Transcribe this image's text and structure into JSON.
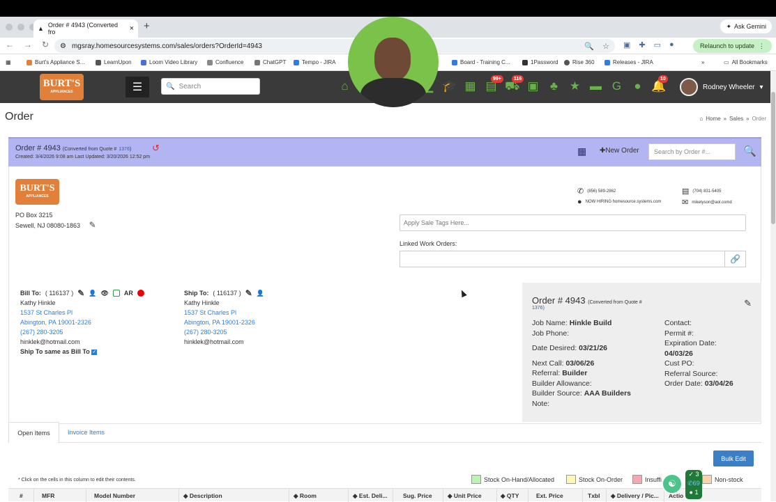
{
  "browser": {
    "tab_title": "Order # 4943 (Converted fro",
    "ask_gemini": "Ask Gemini",
    "url": "mgsray.homesourcesystems.com/sales/orders?OrderId=4943",
    "relaunch": "Relaunch to update",
    "bookmarks": [
      "Burt's Appliance S...",
      "LearnUpon",
      "Loom Video Library",
      "Confluence",
      "ChatGPT",
      "Tempo - JIRA",
      "Board - Training C...",
      "1Password",
      "Rise 360",
      "Releases - JIRA"
    ],
    "all_bookmarks": "All Bookmarks"
  },
  "nav": {
    "logo_text": "BURT'S",
    "logo_sub": "APPLIANCES",
    "search_placeholder": "Search",
    "cart_badge": "99+",
    "cart2_badge": "116",
    "bell_badge": "10",
    "user_name": "Rodney Wheeler"
  },
  "page": {
    "title": "Order",
    "breadcrumb": [
      "Home",
      "Sales",
      "Order"
    ]
  },
  "order_bar": {
    "title": "Order # 4943",
    "converted": "(Converted from Quote #",
    "quote_no": "1376",
    "close_paren": ")",
    "dates": "Created: 3/4/2026 9:08 am     Last Updated: 3/20/2026 12:52 pm",
    "new_order": "New Order",
    "search_placeholder": "Search by Order #..."
  },
  "company": {
    "address1": "PO Box 3215",
    "address2": "Sewell, NJ 08080-1863",
    "phone1": "(856) 589-2862",
    "phone2": "(704) 831-5405",
    "web": "NOW HIRING homesource.systems.com",
    "email": "miketyson@aol.comd"
  },
  "fields": {
    "tags_placeholder": "Apply Sale Tags Here...",
    "linked_label": "Linked Work Orders:"
  },
  "bill_to": {
    "label": "Bill To:",
    "id": "( 116137 )",
    "ar": "AR",
    "name": "Kathy Hinkle",
    "street": "1537 St Charles Pl",
    "city": "Abington, PA 19001-2326",
    "phone": "(267) 280-3205",
    "email": "hinklek@hotmail.com",
    "same_label": "Ship To same as Bill To"
  },
  "ship_to": {
    "label": "Ship To:",
    "id": "( 116137 )",
    "name": "Kathy Hinkle",
    "street": "1537 St Charles Pl",
    "city": "Abington, PA 19001-2326",
    "phone": "(267) 280-3205",
    "email": "hinklek@hotmail.com"
  },
  "summary": {
    "title": "Order # 4943",
    "converted": "(Converted from Quote #",
    "quote_ref": "1376)",
    "job_name_l": "Job Name:",
    "job_name": "Hinkle Build",
    "job_phone_l": "Job Phone:",
    "date_desired_l": "Date Desired:",
    "date_desired": "03/21/26",
    "next_call_l": "Next Call:",
    "next_call": "03/06/26",
    "referral_l": "Referral:",
    "referral": "Builder",
    "builder_allow_l": "Builder Allowance:",
    "builder_src_l": "Builder Source:",
    "builder_src": "AAA Builders",
    "note_l": "Note:",
    "contact_l": "Contact:",
    "permit_l": "Permit #:",
    "exp_l": "Expiration Date:",
    "exp": "04/03/26",
    "cust_po_l": "Cust PO:",
    "ref_src_l": "Referral Source:",
    "order_date_l": "Order Date:",
    "order_date": "03/04/26"
  },
  "tabs": {
    "open": "Open Items",
    "invoice": "Invoice Items"
  },
  "table": {
    "bulk_edit": "Bulk Edit",
    "note": "* Click on the cells in this column to edit their contents.",
    "legend": [
      {
        "label": "Stock On-Hand/Allocated",
        "color": "#b9f5b0"
      },
      {
        "label": "Stock On-Order",
        "color": "#fdf7b2"
      },
      {
        "label": "Insuffi",
        "color": "#f6a7b0"
      },
      {
        "label": "Non-stock",
        "color": "#fbd3a8"
      }
    ],
    "headers": [
      "#",
      "MFR",
      "Model Number",
      "Description",
      "Room",
      "Est. Deli...",
      "Sug. Price",
      "Unit Price",
      "QTY",
      "Ext. Price",
      "Txbl",
      "Delivery / Pic...",
      "Actio"
    ]
  },
  "widgets": {
    "count_top": "3",
    "count_mid": "69",
    "count_bot": "1"
  }
}
